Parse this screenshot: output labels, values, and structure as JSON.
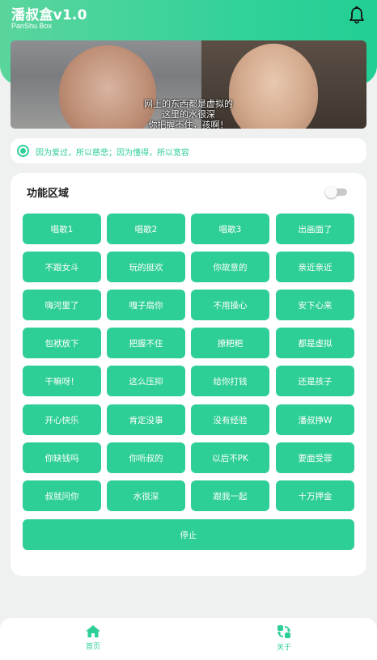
{
  "header": {
    "title": "潘叔盒v1.0",
    "subtitle": "PanShu Box"
  },
  "video": {
    "caption_line1": "网上的东西都是虚拟的",
    "caption_line2": "这里的水很深",
    "caption_line3": "你把握不住，孩啊！"
  },
  "marquee": {
    "text": "因为爱过，所以慈悲；因为懂得，所以宽容"
  },
  "panel": {
    "title": "功能区域",
    "toggle_on": false,
    "buttons": [
      "唱歌1",
      "唱歌2",
      "唱歌3",
      "出画面了",
      "不跟女斗",
      "玩的挺欢",
      "你故意的",
      "亲近亲近",
      "嗨河里了",
      "嘎子扇你",
      "不用操心",
      "安下心来",
      "包袱放下",
      "把握不住",
      "撩粑粑",
      "都是虚拟",
      "干嘛呀！",
      "这么压抑",
      "给你打钱",
      "还是孩子",
      "开心快乐",
      "肯定没事",
      "没有经验",
      "潘叔挣W",
      "你缺钱吗",
      "你听叔的",
      "以后不PK",
      "要面受罪",
      "叔就问你",
      "水很深",
      "跟我一起",
      "十万押金"
    ],
    "stop_label": "停止"
  },
  "nav": {
    "items": [
      {
        "label": "首页",
        "icon": "home-icon"
      },
      {
        "label": "关于",
        "icon": "about-icon"
      }
    ]
  },
  "colors": {
    "accent": "#2ecf96",
    "header_gradient_start": "#5ad59c",
    "header_gradient_end": "#22cf94"
  }
}
